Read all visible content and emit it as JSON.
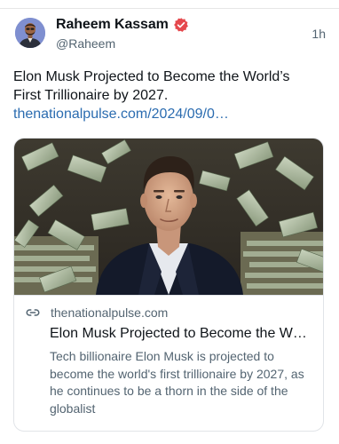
{
  "post": {
    "author": {
      "display_name": "Raheem Kassam",
      "handle": "@Raheem",
      "verified_icon": "verified-badge-icon",
      "verified_color": "#e5484d"
    },
    "timestamp": "1h",
    "text": "Elon Musk Projected to Become the World’s First Trillionaire by 2027.",
    "link_text": "thenationalpulse.com/2024/09/0…",
    "link_color": "#2b6cb0"
  },
  "card": {
    "image_icon": "article-thumbnail",
    "domain_icon": "link-icon",
    "domain": "thenationalpulse.com",
    "title": "Elon Musk Projected to Become the W…",
    "description": "Tech billionaire Elon Musk is projected to become the world's first trillionaire by 2027, as he continues to be a thorn in the side of the globalist"
  }
}
